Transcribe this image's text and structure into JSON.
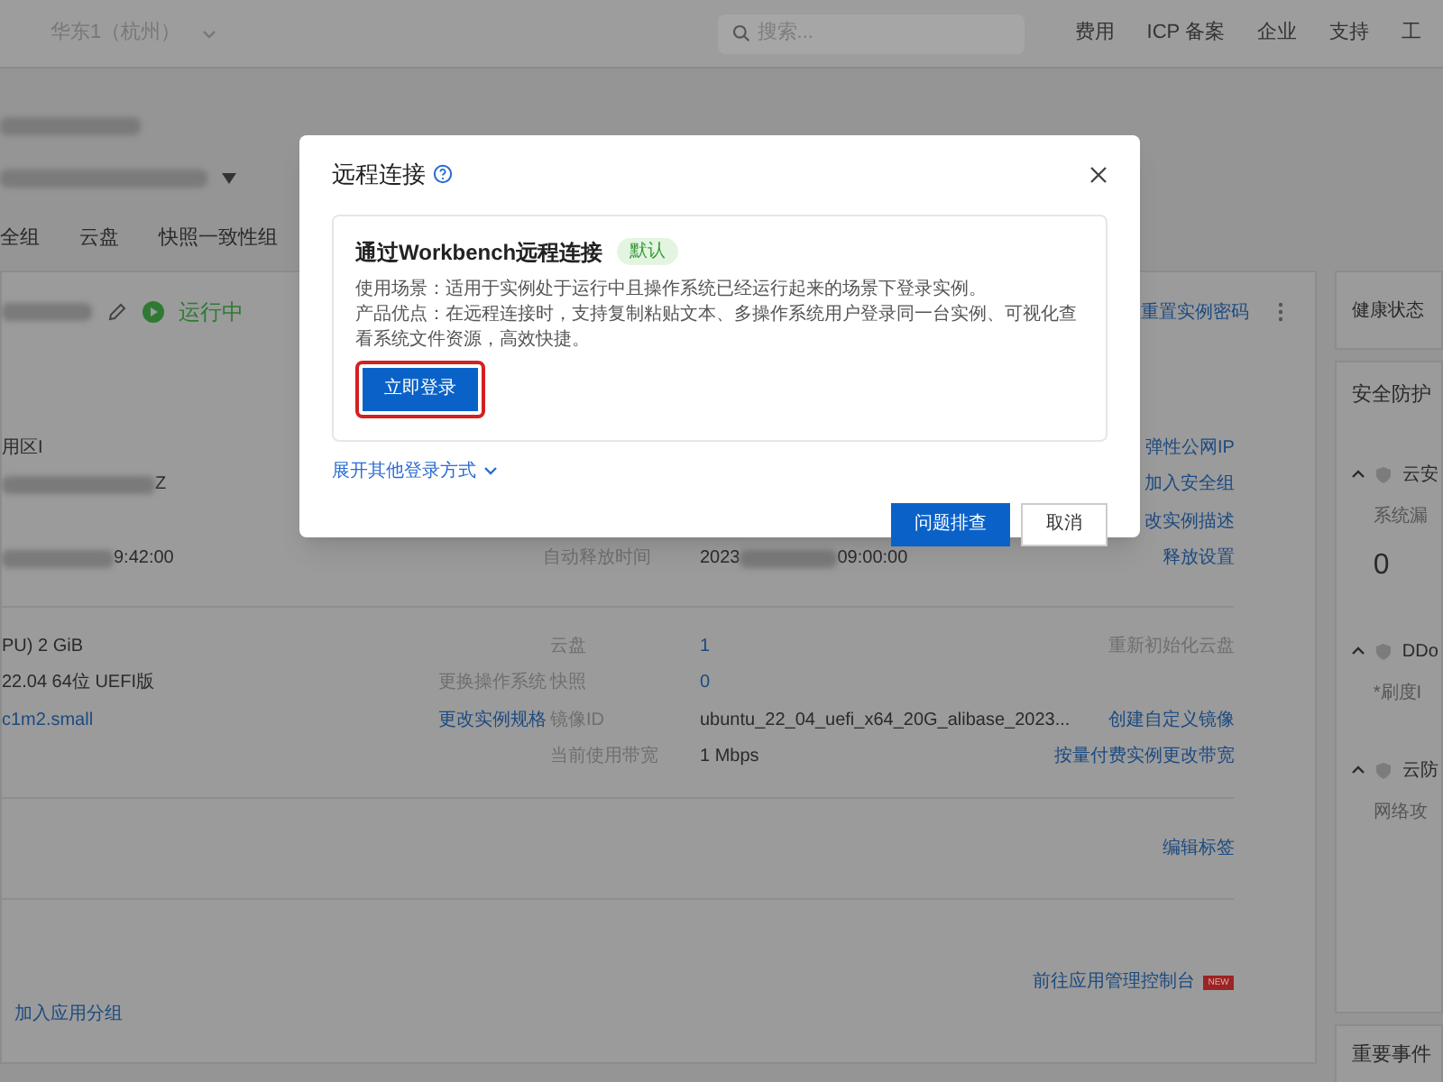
{
  "top_bar": {
    "region": "华东1（杭州）",
    "search": {
      "placeholder": "搜索..."
    },
    "links": [
      "费用",
      "ICP 备案",
      "企业",
      "支持",
      "工"
    ]
  },
  "tabs": [
    {
      "label": "全组",
      "selected": false
    },
    {
      "label": "云盘",
      "selected": false
    },
    {
      "label": "快照一致性组",
      "selected": false
    }
  ],
  "instance": {
    "status": "运行中",
    "actions": [
      "重置实例密码"
    ]
  },
  "info_rows": [
    {
      "left": "用区I",
      "left_redacted": false,
      "label": "",
      "value": "",
      "action": "弹性公网IP"
    },
    {
      "left": "Z",
      "left_redacted": true,
      "label": "",
      "value": "",
      "action": "加入安全组"
    },
    {
      "left": "",
      "left_redacted": false,
      "label": "",
      "value": "",
      "action": "改实例描述"
    },
    {
      "left": "9:42:00",
      "left_redacted": true,
      "label": "自动释放时间",
      "value": "2023",
      "value_suffix": "09:00:00",
      "action": "释放设置"
    }
  ],
  "config_rows": [
    {
      "left": "PU)  2 GiB",
      "left_link": false,
      "left_action": "",
      "label": "云盘",
      "value": "1",
      "value_link": true,
      "action": "重新初始化云盘",
      "action_disabled": true
    },
    {
      "left": "22.04 64位 UEFI版",
      "left_link": false,
      "left_action": "更换操作系统",
      "left_action_disabled": true,
      "label": "快照",
      "value": "0",
      "value_link": true,
      "action": ""
    },
    {
      "left": "c1m2.small",
      "left_link": true,
      "left_action": "更改实例规格",
      "left_action_disabled": false,
      "label": "镜像ID",
      "value": "ubuntu_22_04_uefi_x64_20G_alibase_2023...",
      "value_link": false,
      "action": "创建自定义镜像",
      "action_disabled": false
    },
    {
      "left": "",
      "left_action": "",
      "label": "当前使用带宽",
      "value": "1 Mbps",
      "value_link": false,
      "action": "按量付费实例更改带宽",
      "action_disabled": false
    }
  ],
  "tags_action": "编辑标签",
  "app": {
    "console_link": "前往应用管理控制台",
    "badge": "NEW",
    "group_link": "加入应用分组"
  },
  "side": {
    "health": "健康状态",
    "security": {
      "title": "安全防护",
      "groups": [
        {
          "name": "云安",
          "expanded": true,
          "lines": [
            "系统漏",
            "0"
          ]
        },
        {
          "name": "DDo",
          "expanded": true,
          "lines": [
            "*刷度I"
          ]
        },
        {
          "name": "云防",
          "expanded": true,
          "lines": [
            "网络攻"
          ]
        }
      ]
    },
    "events": "重要事件"
  },
  "dialog": {
    "title": "远程连接",
    "option": {
      "title": "通过Workbench远程连接",
      "badge": "默认",
      "usage": "使用场景：适用于实例处于运行中且操作系统已经运行起来的场景下登录实例。",
      "advantage": "产品优点：在远程连接时，支持复制粘贴文本、多操作系统用户登录同一台实例、可视化查看系统文件资源，高效快捷。",
      "button": "立即登录"
    },
    "expand": "展开其他登录方式",
    "buttons": [
      {
        "label": "问题排查",
        "primary": true
      },
      {
        "label": "取消",
        "primary": false
      }
    ]
  }
}
